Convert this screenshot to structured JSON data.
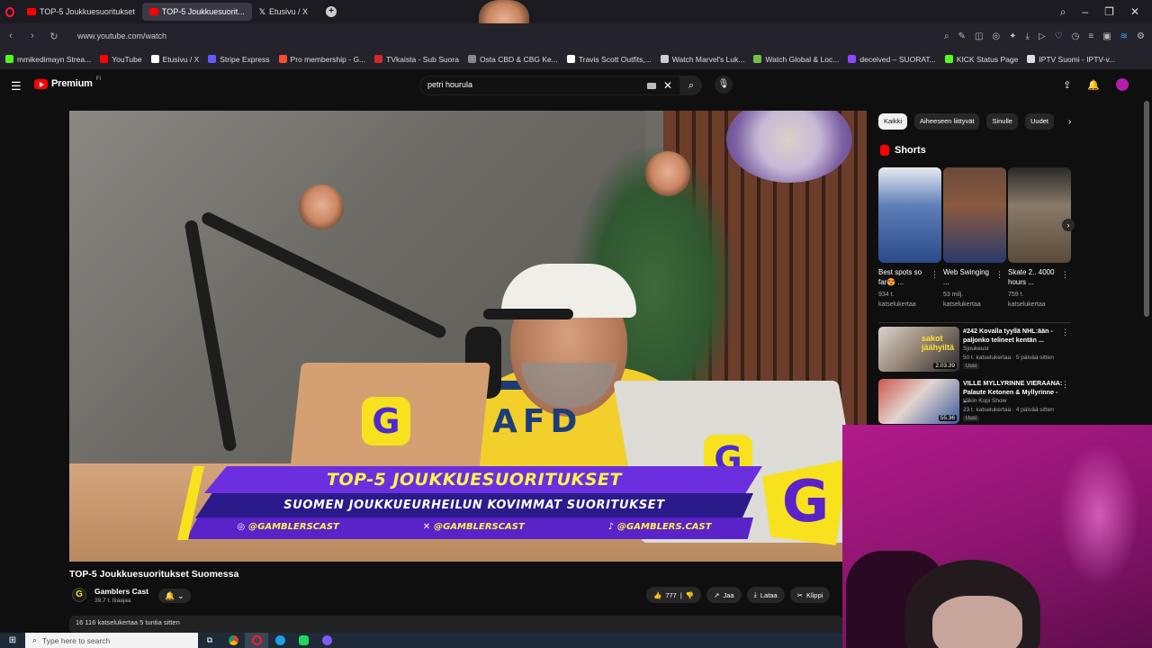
{
  "browser": {
    "tabs": [
      {
        "label": "TOP-5 Joukkuesuoritukset",
        "icon": "youtube-icon",
        "active": false
      },
      {
        "label": "TOP-5 Joukkuesuorit...",
        "icon": "youtube-icon",
        "active": true
      },
      {
        "label": "Etusivu / X",
        "icon": "x-icon",
        "active": false
      }
    ],
    "new_tab": "+",
    "window_controls": [
      "search-icon",
      "minimize-icon",
      "maximize-icon",
      "close-icon"
    ],
    "url": "www.youtube.com/watch"
  },
  "bookmarks": [
    {
      "label": "mmikedimayn Strea...",
      "color": "#53fc18"
    },
    {
      "label": "YouTube",
      "color": "#ff0000"
    },
    {
      "label": "Etusivu / X",
      "color": "#ffffff"
    },
    {
      "label": "Stripe Express",
      "color": "#635bff"
    },
    {
      "label": "Pro membership - G...",
      "color": "#ff4a2e"
    },
    {
      "label": "TVkaista - Sub Suora",
      "color": "#d6262e"
    },
    {
      "label": "Osta CBD & CBG Ke...",
      "color": "#888888"
    },
    {
      "label": "Travis Scott Outfits,...",
      "color": "#ffffff"
    },
    {
      "label": "Watch Marvel's Luk...",
      "color": "#cccccc"
    },
    {
      "label": "Watch Global & Loc...",
      "color": "#76c043"
    },
    {
      "label": "deceived – SUORAT...",
      "color": "#9146ff"
    },
    {
      "label": "KICK Status Page",
      "color": "#53fc18"
    },
    {
      "label": "IPTV Suomi - IPTV-v...",
      "color": "#dddddd"
    }
  ],
  "youtube": {
    "logo_text": "Premium",
    "logo_sup": "FI",
    "search_value": "petri hourula"
  },
  "video": {
    "banner_title": "TOP-5 JOUKKUESUORITUKSET",
    "banner_subtitle": "SUOMEN JOUKKUEURHEILUN KOVIMMAT SUORITUKSET",
    "socials": [
      "@GAMBLERSCAST",
      "@GAMBLERSCAST",
      "@GAMBLERS.CAST"
    ],
    "jersey": "AFD",
    "logo_letter": "G",
    "title": "TOP-5 Joukkuesuoritukset Suomessa",
    "channel": "Gamblers Cast",
    "channel_avatar": "G",
    "subscribers": "39,7 t. tilaajaa",
    "likes": "777",
    "share_label": "Jaa",
    "download_label": "Lataa",
    "clip_label": "Klippi",
    "views_line": "16 116 katselukertaa  5 tuntia sitten"
  },
  "sidebar": {
    "chips": [
      "Kaikki",
      "Aiheeseen liittyvät",
      "Sinulle",
      "Uudet"
    ],
    "shorts_heading": "Shorts",
    "shorts": [
      {
        "title": "Best spots so far😍 ...",
        "views": "934 t. katselukertaa"
      },
      {
        "title": "Web Swinging ...",
        "views": "53 milj. katselukertaa"
      },
      {
        "title": "Skate 2.. 4000 hours ...",
        "views": "759 t. katselukertaa"
      }
    ],
    "recommendations": [
      {
        "title": "#242 Kovalla tyyllä NHL:ään - paljonko telineet kentän ...",
        "channel": "Sjoukeust",
        "meta": "50 t. katselukertaa · 5 päivää sitten",
        "badge": "Uusi",
        "duration": "2.03.39",
        "thumb_text": "sakot jäähyiltä"
      },
      {
        "title": "VILLE MYLLYRINNE VIERAANA: Palaute Ketonen & Myllyrinne - ...",
        "channel": "Viikin Kopi Show",
        "meta": "23 t. katselukertaa · 4 päivää sitten",
        "badge": "Uusi",
        "duration": "55.36",
        "thumb_text": ""
      }
    ]
  },
  "taskbar": {
    "search_placeholder": "Type here to search"
  }
}
